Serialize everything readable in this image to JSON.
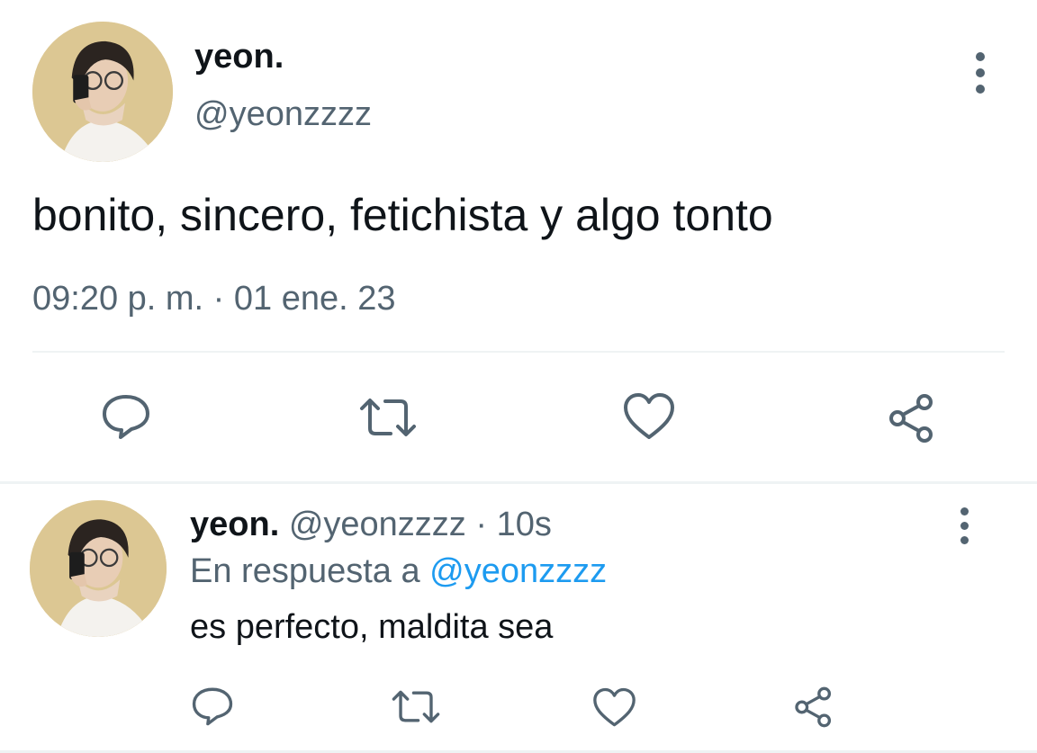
{
  "tweet": {
    "author_name": "yeon.",
    "author_handle": "@yeonzzzz",
    "text": "bonito, sincero, fetichista y algo tonto",
    "timestamp": "09:20 p. m. · 01 ene. 23"
  },
  "reply": {
    "author_name": "yeon.",
    "author_handle": "@yeonzzzz",
    "age": "· 10s",
    "in_reply_to_label": "En respuesta a",
    "in_reply_to_handle": "@yeonzzzz",
    "text": "es perfecto, maldita sea"
  },
  "icons": {
    "avatar": "avatar",
    "more": "more-vertical-icon",
    "reply": "comment-icon",
    "retweet": "retweet-icon",
    "like": "heart-icon",
    "share": "share-icon"
  },
  "colors": {
    "text_primary": "#0f1419",
    "text_secondary": "#536471",
    "link": "#1d9bf0",
    "icon": "#536471",
    "divider": "#eff3f4"
  }
}
